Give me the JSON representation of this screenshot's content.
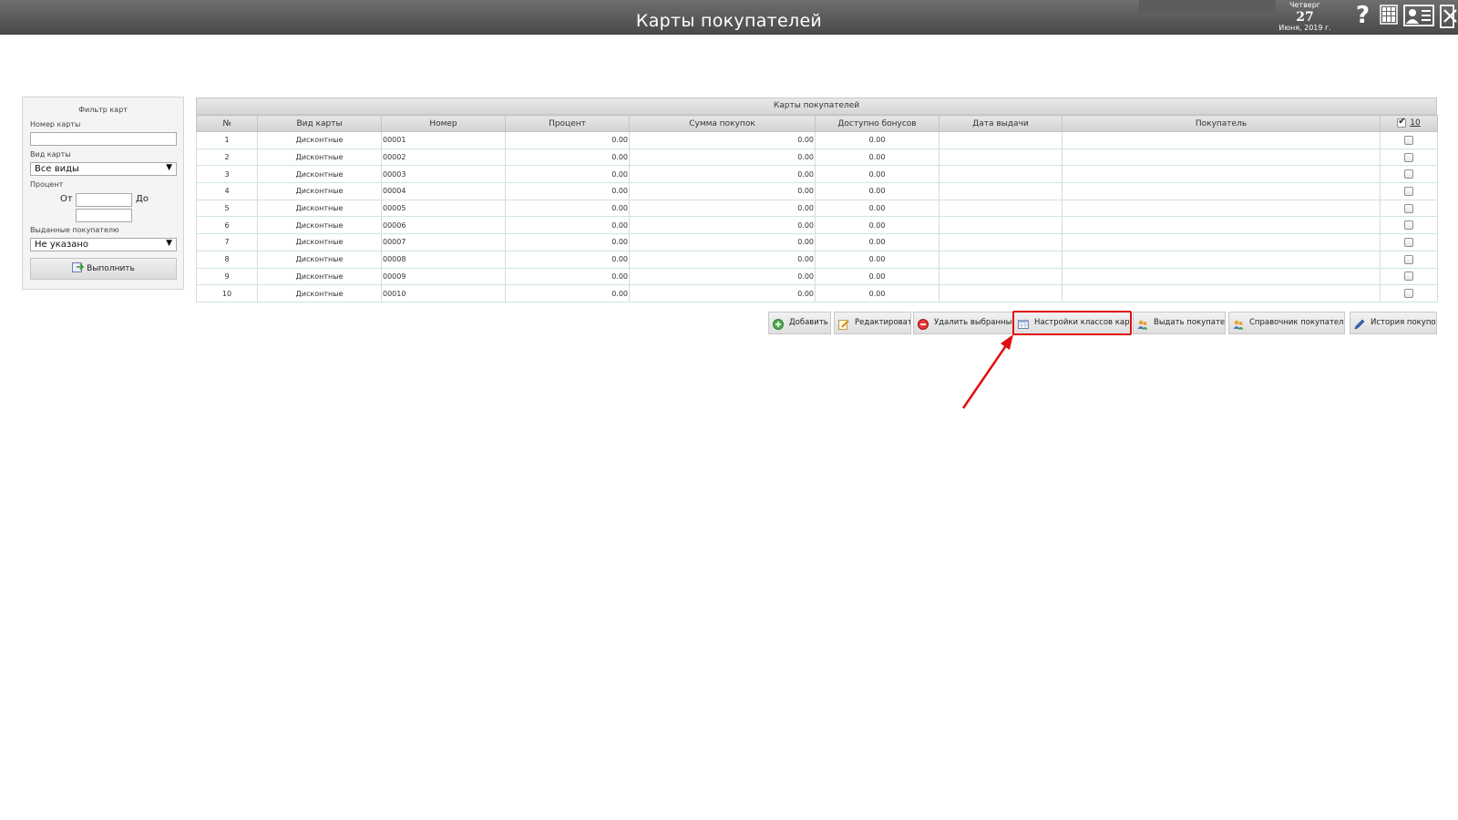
{
  "header": {
    "title": "Карты покупателей",
    "date": {
      "weekday": "Четверг",
      "day": "27",
      "month_year": "Июня, 2019 г."
    },
    "icons": [
      "help-icon",
      "grid-icon",
      "user-card-icon",
      "exit-icon"
    ],
    "help_glyph": "?"
  },
  "filter": {
    "title": "Фильтр карт",
    "card_number_label": "Номер карты",
    "card_number_value": "",
    "card_type_label": "Вид карты",
    "card_type_value": "Все виды",
    "percent_label": "Процент",
    "from_label": "От",
    "to_label": "До",
    "percent_from": "",
    "percent_to": "",
    "issued_label": "Выданные покупателю",
    "issued_value": "Не указано",
    "run_button": "Выполнить"
  },
  "table": {
    "caption": "Карты покупателей",
    "columns": [
      "№",
      "Вид карты",
      "Номер",
      "Процент",
      "Сумма покупок",
      "Доступно бонусов",
      "Дата выдачи",
      "Покупатель"
    ],
    "select_count": "10",
    "rows": [
      {
        "n": "1",
        "type": "Дисконтные",
        "number": "00001",
        "percent": "0.00",
        "sum": "0.00",
        "bonus": "0.00",
        "date": "",
        "buyer": ""
      },
      {
        "n": "2",
        "type": "Дисконтные",
        "number": "00002",
        "percent": "0.00",
        "sum": "0.00",
        "bonus": "0.00",
        "date": "",
        "buyer": ""
      },
      {
        "n": "3",
        "type": "Дисконтные",
        "number": "00003",
        "percent": "0.00",
        "sum": "0.00",
        "bonus": "0.00",
        "date": "",
        "buyer": ""
      },
      {
        "n": "4",
        "type": "Дисконтные",
        "number": "00004",
        "percent": "0.00",
        "sum": "0.00",
        "bonus": "0.00",
        "date": "",
        "buyer": ""
      },
      {
        "n": "5",
        "type": "Дисконтные",
        "number": "00005",
        "percent": "0.00",
        "sum": "0.00",
        "bonus": "0.00",
        "date": "",
        "buyer": ""
      },
      {
        "n": "6",
        "type": "Дисконтные",
        "number": "00006",
        "percent": "0.00",
        "sum": "0.00",
        "bonus": "0.00",
        "date": "",
        "buyer": ""
      },
      {
        "n": "7",
        "type": "Дисконтные",
        "number": "00007",
        "percent": "0.00",
        "sum": "0.00",
        "bonus": "0.00",
        "date": "",
        "buyer": ""
      },
      {
        "n": "8",
        "type": "Дисконтные",
        "number": "00008",
        "percent": "0.00",
        "sum": "0.00",
        "bonus": "0.00",
        "date": "",
        "buyer": ""
      },
      {
        "n": "9",
        "type": "Дисконтные",
        "number": "00009",
        "percent": "0.00",
        "sum": "0.00",
        "bonus": "0.00",
        "date": "",
        "buyer": ""
      },
      {
        "n": "10",
        "type": "Дисконтные",
        "number": "00010",
        "percent": "0.00",
        "sum": "0.00",
        "bonus": "0.00",
        "date": "",
        "buyer": ""
      }
    ]
  },
  "actions": {
    "add": "Добавить",
    "edit": "Редактировать",
    "delete_selected": "Удалить выбранные",
    "card_class_settings": "Настройки классов карт",
    "issue_to_buyer": "Выдать покупателю",
    "buyers_directory": "Справочник покупателей",
    "purchase_history": "История покупок"
  },
  "colors": {
    "header_bg": "#555555",
    "highlight": "#e01010",
    "panel_bg": "#f4f4f4"
  }
}
